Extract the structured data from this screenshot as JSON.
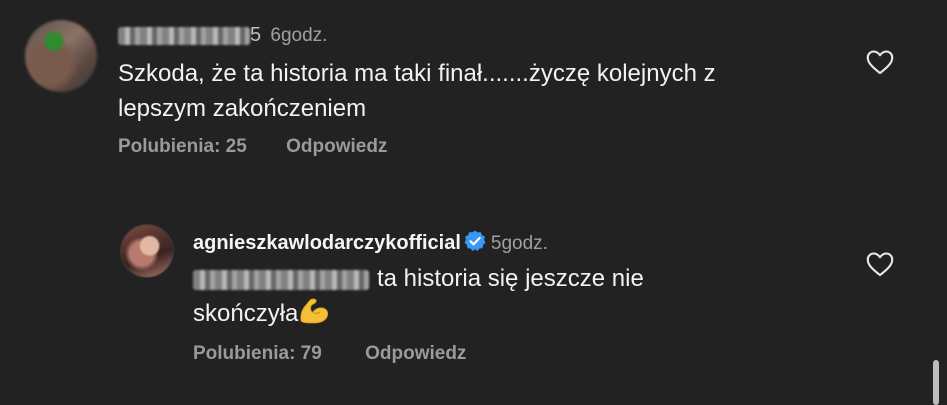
{
  "comments": [
    {
      "username_tail": "5",
      "time": "6godz.",
      "text_line1": "Szkoda, że ta historia ma taki finał.......życzę kolejnych z",
      "text_line2": "lepszym zakończeniem",
      "likes_label": "Polubienia: 25",
      "reply_label": "Odpowiedz"
    },
    {
      "username": "agnieszkawlodarczykofficial",
      "time": "5godz.",
      "text_line1": "ta historia się jeszcze nie",
      "text_line2": "skończyła",
      "likes_label": "Polubienia: 79",
      "reply_label": "Odpowiedz"
    }
  ],
  "icons": {
    "like": "heart-outline-icon",
    "verified": "verified-badge-icon",
    "emoji": "flexed-biceps-emoji"
  },
  "colors": {
    "background": "#222222",
    "verified": "#3897f0",
    "muted_text": "#9a9a9a"
  }
}
